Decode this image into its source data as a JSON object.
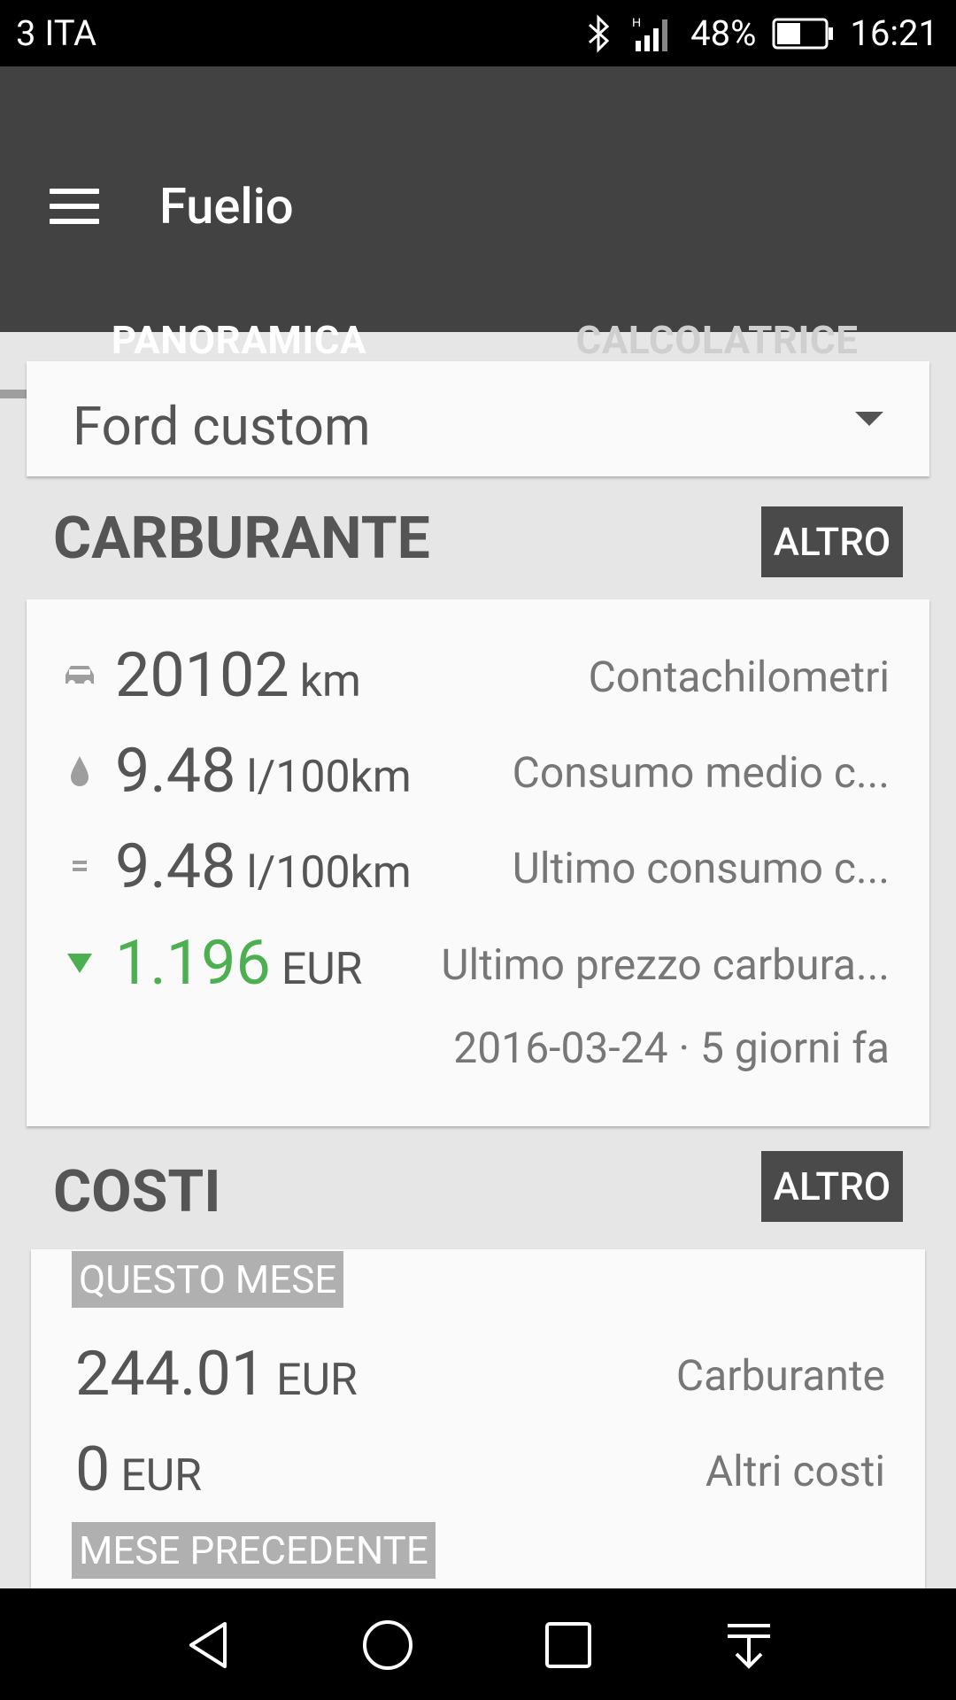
{
  "status_bar": {
    "carrier": "3 ITA",
    "battery": "48%",
    "time": "16:21"
  },
  "app_bar": {
    "title": "Fuelio"
  },
  "tabs": [
    {
      "label": "PANORAMICA"
    },
    {
      "label": "CALCOLATRICE"
    }
  ],
  "vehicle": {
    "name": "Ford custom"
  },
  "fuel": {
    "title": "CARBURANTE",
    "more_label": "ALTRO",
    "rows": [
      {
        "value": "20102",
        "unit": "km",
        "label": "Contachilometri"
      },
      {
        "value": "9.48",
        "unit": "l/100km",
        "label": "Consumo medio c..."
      },
      {
        "value": "9.48",
        "unit": "l/100km",
        "label": "Ultimo consumo c..."
      },
      {
        "value": "1.196",
        "unit": "EUR",
        "label": "Ultimo prezzo carbura..."
      }
    ],
    "date": "2016-03-24 · 5 giorni fa"
  },
  "costs": {
    "title": "COSTI",
    "more_label": "ALTRO",
    "this_month_label": "QUESTO MESE",
    "rows": [
      {
        "value": "244.01",
        "unit": "EUR",
        "label": "Carburante"
      },
      {
        "value": "0",
        "unit": "EUR",
        "label": "Altri costi"
      }
    ],
    "prev_month_label": "MESE PRECEDENTE"
  },
  "colors": {
    "appbar": "#424242",
    "accent_green": "#4caf50"
  },
  "icons": [
    "menu-icon",
    "car-icon",
    "drop-icon",
    "equals-icon",
    "price-down-icon",
    "dropdown-arrow-icon",
    "back-icon",
    "home-icon",
    "recents-icon",
    "notification-pull-icon"
  ]
}
